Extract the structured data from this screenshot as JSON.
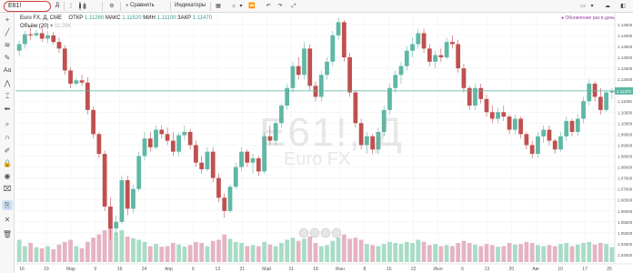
{
  "toolbar": {
    "symbol_value": "E61!",
    "interval": "Д",
    "compare_label": "Сравнить",
    "indicators_label": "Индикаторы"
  },
  "legend": {
    "title": "Euro FX, Д, CME",
    "open_label": "ОТКР",
    "open_value": "1.11260",
    "high_label": "МАКС",
    "high_value": "1.11520",
    "low_label": "МИН",
    "low_value": "1.11100",
    "close_label": "ЗАКР",
    "close_value": "1.11470",
    "volume_label": "Объём (20)",
    "volume_value": "11.29K"
  },
  "notice": "● Обновление раз в день",
  "watermark": {
    "symbol": "E61!, Д",
    "name": "Euro FX"
  },
  "price_axis": {
    "labels": [
      "1.14500",
      "1.14000",
      "1.13500",
      "1.13000",
      "1.12500",
      "1.12000",
      "1.11500",
      "1.11000",
      "1.10500",
      "1.10000",
      "1.09500",
      "1.09000",
      "1.08500",
      "1.08000",
      "1.07500",
      "1.07000",
      "1.06500",
      "1.06000",
      "1.05500",
      "1.05000",
      "1.04500",
      "1.04000"
    ],
    "last_price": "1.11470"
  },
  "time_axis": {
    "labels": [
      "16",
      "19",
      "Мар",
      "9",
      "16",
      "24",
      "Апр",
      "6",
      "13",
      "21",
      "Май",
      "11",
      "18",
      "Июн",
      "8",
      "15",
      "22",
      "Июл",
      "6",
      "13",
      "20",
      "Авг",
      "10",
      "17",
      "25"
    ]
  },
  "chart_data": {
    "type": "candlestick",
    "series": [
      {
        "o": 1.133,
        "h": 1.1375,
        "l": 1.1305,
        "c": 1.136
      },
      {
        "o": 1.136,
        "h": 1.142,
        "l": 1.134,
        "c": 1.1405
      },
      {
        "o": 1.1405,
        "h": 1.1435,
        "l": 1.138,
        "c": 1.14
      },
      {
        "o": 1.14,
        "h": 1.1425,
        "l": 1.139,
        "c": 1.141
      },
      {
        "o": 1.141,
        "h": 1.144,
        "l": 1.137,
        "c": 1.1385
      },
      {
        "o": 1.1385,
        "h": 1.142,
        "l": 1.1365,
        "c": 1.14
      },
      {
        "o": 1.14,
        "h": 1.1415,
        "l": 1.136,
        "c": 1.137
      },
      {
        "o": 1.137,
        "h": 1.139,
        "l": 1.132,
        "c": 1.134
      },
      {
        "o": 1.134,
        "h": 1.1355,
        "l": 1.122,
        "c": 1.124
      },
      {
        "o": 1.124,
        "h": 1.1255,
        "l": 1.116,
        "c": 1.118
      },
      {
        "o": 1.118,
        "h": 1.1205,
        "l": 1.117,
        "c": 1.1195
      },
      {
        "o": 1.1195,
        "h": 1.122,
        "l": 1.117,
        "c": 1.1185
      },
      {
        "o": 1.1185,
        "h": 1.121,
        "l": 1.104,
        "c": 1.106
      },
      {
        "o": 1.106,
        "h": 1.1075,
        "l": 1.093,
        "c": 1.095
      },
      {
        "o": 1.095,
        "h": 1.096,
        "l": 1.084,
        "c": 1.086
      },
      {
        "o": 1.086,
        "h": 1.0875,
        "l": 1.06,
        "c": 1.062
      },
      {
        "o": 1.062,
        "h": 1.066,
        "l": 1.047,
        "c": 1.052
      },
      {
        "o": 1.052,
        "h": 1.058,
        "l": 1.049,
        "c": 1.055
      },
      {
        "o": 1.055,
        "h": 1.076,
        "l": 1.054,
        "c": 1.074
      },
      {
        "o": 1.074,
        "h": 1.076,
        "l": 1.058,
        "c": 1.061
      },
      {
        "o": 1.061,
        "h": 1.072,
        "l": 1.059,
        "c": 1.07
      },
      {
        "o": 1.07,
        "h": 1.087,
        "l": 1.069,
        "c": 1.085
      },
      {
        "o": 1.085,
        "h": 1.096,
        "l": 1.083,
        "c": 1.093
      },
      {
        "o": 1.093,
        "h": 1.096,
        "l": 1.087,
        "c": 1.089
      },
      {
        "o": 1.089,
        "h": 1.099,
        "l": 1.088,
        "c": 1.097
      },
      {
        "o": 1.097,
        "h": 1.099,
        "l": 1.093,
        "c": 1.095
      },
      {
        "o": 1.095,
        "h": 1.098,
        "l": 1.09,
        "c": 1.092
      },
      {
        "o": 1.092,
        "h": 1.096,
        "l": 1.085,
        "c": 1.087
      },
      {
        "o": 1.087,
        "h": 1.096,
        "l": 1.085,
        "c": 1.0945
      },
      {
        "o": 1.0945,
        "h": 1.099,
        "l": 1.092,
        "c": 1.096
      },
      {
        "o": 1.096,
        "h": 1.0975,
        "l": 1.088,
        "c": 1.09
      },
      {
        "o": 1.09,
        "h": 1.092,
        "l": 1.08,
        "c": 1.082
      },
      {
        "o": 1.082,
        "h": 1.085,
        "l": 1.077,
        "c": 1.079
      },
      {
        "o": 1.079,
        "h": 1.089,
        "l": 1.078,
        "c": 1.087
      },
      {
        "o": 1.087,
        "h": 1.089,
        "l": 1.073,
        "c": 1.075
      },
      {
        "o": 1.075,
        "h": 1.077,
        "l": 1.064,
        "c": 1.066
      },
      {
        "o": 1.066,
        "h": 1.068,
        "l": 1.057,
        "c": 1.06
      },
      {
        "o": 1.06,
        "h": 1.072,
        "l": 1.059,
        "c": 1.071
      },
      {
        "o": 1.071,
        "h": 1.082,
        "l": 1.07,
        "c": 1.08
      },
      {
        "o": 1.08,
        "h": 1.089,
        "l": 1.078,
        "c": 1.087
      },
      {
        "o": 1.087,
        "h": 1.088,
        "l": 1.08,
        "c": 1.082
      },
      {
        "o": 1.082,
        "h": 1.086,
        "l": 1.077,
        "c": 1.084
      },
      {
        "o": 1.084,
        "h": 1.085,
        "l": 1.076,
        "c": 1.078
      },
      {
        "o": 1.078,
        "h": 1.096,
        "l": 1.077,
        "c": 1.094
      },
      {
        "o": 1.094,
        "h": 1.099,
        "l": 1.09,
        "c": 1.092
      },
      {
        "o": 1.092,
        "h": 1.101,
        "l": 1.09,
        "c": 1.1
      },
      {
        "o": 1.1,
        "h": 1.109,
        "l": 1.098,
        "c": 1.108
      },
      {
        "o": 1.108,
        "h": 1.118,
        "l": 1.106,
        "c": 1.116
      },
      {
        "o": 1.116,
        "h": 1.128,
        "l": 1.114,
        "c": 1.126
      },
      {
        "o": 1.126,
        "h": 1.13,
        "l": 1.12,
        "c": 1.122
      },
      {
        "o": 1.122,
        "h": 1.137,
        "l": 1.12,
        "c": 1.134
      },
      {
        "o": 1.134,
        "h": 1.136,
        "l": 1.115,
        "c": 1.117
      },
      {
        "o": 1.117,
        "h": 1.119,
        "l": 1.11,
        "c": 1.112
      },
      {
        "o": 1.112,
        "h": 1.124,
        "l": 1.11,
        "c": 1.122
      },
      {
        "o": 1.122,
        "h": 1.13,
        "l": 1.12,
        "c": 1.128
      },
      {
        "o": 1.128,
        "h": 1.142,
        "l": 1.126,
        "c": 1.14
      },
      {
        "o": 1.14,
        "h": 1.148,
        "l": 1.138,
        "c": 1.146
      },
      {
        "o": 1.146,
        "h": 1.147,
        "l": 1.128,
        "c": 1.13
      },
      {
        "o": 1.13,
        "h": 1.132,
        "l": 1.112,
        "c": 1.114
      },
      {
        "o": 1.114,
        "h": 1.115,
        "l": 1.098,
        "c": 1.1
      },
      {
        "o": 1.1,
        "h": 1.102,
        "l": 1.088,
        "c": 1.09
      },
      {
        "o": 1.09,
        "h": 1.096,
        "l": 1.086,
        "c": 1.094
      },
      {
        "o": 1.094,
        "h": 1.095,
        "l": 1.086,
        "c": 1.088
      },
      {
        "o": 1.088,
        "h": 1.098,
        "l": 1.086,
        "c": 1.096
      },
      {
        "o": 1.096,
        "h": 1.108,
        "l": 1.094,
        "c": 1.106
      },
      {
        "o": 1.106,
        "h": 1.118,
        "l": 1.104,
        "c": 1.116
      },
      {
        "o": 1.116,
        "h": 1.124,
        "l": 1.114,
        "c": 1.122
      },
      {
        "o": 1.122,
        "h": 1.128,
        "l": 1.118,
        "c": 1.126
      },
      {
        "o": 1.126,
        "h": 1.135,
        "l": 1.124,
        "c": 1.133
      },
      {
        "o": 1.133,
        "h": 1.139,
        "l": 1.13,
        "c": 1.136
      },
      {
        "o": 1.136,
        "h": 1.143,
        "l": 1.134,
        "c": 1.141
      },
      {
        "o": 1.141,
        "h": 1.143,
        "l": 1.132,
        "c": 1.134
      },
      {
        "o": 1.134,
        "h": 1.136,
        "l": 1.126,
        "c": 1.128
      },
      {
        "o": 1.128,
        "h": 1.133,
        "l": 1.125,
        "c": 1.131
      },
      {
        "o": 1.131,
        "h": 1.134,
        "l": 1.128,
        "c": 1.13
      },
      {
        "o": 1.13,
        "h": 1.139,
        "l": 1.129,
        "c": 1.137
      },
      {
        "o": 1.137,
        "h": 1.14,
        "l": 1.134,
        "c": 1.136
      },
      {
        "o": 1.136,
        "h": 1.138,
        "l": 1.123,
        "c": 1.125
      },
      {
        "o": 1.125,
        "h": 1.127,
        "l": 1.114,
        "c": 1.116
      },
      {
        "o": 1.116,
        "h": 1.117,
        "l": 1.106,
        "c": 1.108
      },
      {
        "o": 1.108,
        "h": 1.118,
        "l": 1.106,
        "c": 1.116
      },
      {
        "o": 1.116,
        "h": 1.118,
        "l": 1.109,
        "c": 1.111
      },
      {
        "o": 1.111,
        "h": 1.113,
        "l": 1.103,
        "c": 1.105
      },
      {
        "o": 1.105,
        "h": 1.108,
        "l": 1.1,
        "c": 1.102
      },
      {
        "o": 1.102,
        "h": 1.107,
        "l": 1.1,
        "c": 1.105
      },
      {
        "o": 1.105,
        "h": 1.108,
        "l": 1.101,
        "c": 1.103
      },
      {
        "o": 1.103,
        "h": 1.104,
        "l": 1.095,
        "c": 1.097
      },
      {
        "o": 1.097,
        "h": 1.104,
        "l": 1.095,
        "c": 1.102
      },
      {
        "o": 1.102,
        "h": 1.103,
        "l": 1.093,
        "c": 1.095
      },
      {
        "o": 1.095,
        "h": 1.096,
        "l": 1.088,
        "c": 1.09
      },
      {
        "o": 1.09,
        "h": 1.092,
        "l": 1.084,
        "c": 1.086
      },
      {
        "o": 1.086,
        "h": 1.096,
        "l": 1.084,
        "c": 1.094
      },
      {
        "o": 1.094,
        "h": 1.099,
        "l": 1.091,
        "c": 1.097
      },
      {
        "o": 1.097,
        "h": 1.099,
        "l": 1.09,
        "c": 1.092
      },
      {
        "o": 1.092,
        "h": 1.093,
        "l": 1.086,
        "c": 1.088
      },
      {
        "o": 1.088,
        "h": 1.096,
        "l": 1.087,
        "c": 1.094
      },
      {
        "o": 1.094,
        "h": 1.103,
        "l": 1.092,
        "c": 1.101
      },
      {
        "o": 1.101,
        "h": 1.102,
        "l": 1.094,
        "c": 1.096
      },
      {
        "o": 1.096,
        "h": 1.104,
        "l": 1.094,
        "c": 1.102
      },
      {
        "o": 1.102,
        "h": 1.112,
        "l": 1.1,
        "c": 1.11
      },
      {
        "o": 1.11,
        "h": 1.12,
        "l": 1.108,
        "c": 1.118
      },
      {
        "o": 1.118,
        "h": 1.119,
        "l": 1.11,
        "c": 1.112
      },
      {
        "o": 1.112,
        "h": 1.116,
        "l": 1.104,
        "c": 1.106
      },
      {
        "o": 1.106,
        "h": 1.115,
        "l": 1.105,
        "c": 1.114
      },
      {
        "o": 1.114,
        "h": 1.116,
        "l": 1.111,
        "c": 1.1147
      }
    ],
    "volumes": [
      420,
      300,
      360,
      280,
      260,
      300,
      240,
      330,
      380,
      420,
      300,
      260,
      380,
      460,
      520,
      600,
      720,
      560,
      600,
      480,
      450,
      420,
      380,
      300,
      340,
      290,
      300,
      360,
      330,
      290,
      320,
      380,
      360,
      300,
      400,
      420,
      520,
      440,
      380,
      360,
      300,
      320,
      300,
      380,
      330,
      300,
      360,
      420,
      460,
      400,
      440,
      480,
      360,
      300,
      320,
      400,
      460,
      520,
      440,
      460,
      420,
      340,
      320,
      300,
      340,
      380,
      360,
      340,
      380,
      360,
      420,
      380,
      320,
      340,
      300,
      320,
      300,
      360,
      400,
      360,
      330,
      300,
      340,
      320,
      290,
      300,
      360,
      330,
      340,
      380,
      360,
      320,
      300,
      320,
      300,
      340,
      360,
      300,
      330,
      360,
      380,
      330,
      360,
      340,
      280
    ],
    "ylim": [
      1.04,
      1.147
    ],
    "up_color": "#5fb7a5",
    "down_color": "#c0504f",
    "vol_up_color": "#a8dcc6",
    "vol_down_color": "#e5b4c4"
  }
}
